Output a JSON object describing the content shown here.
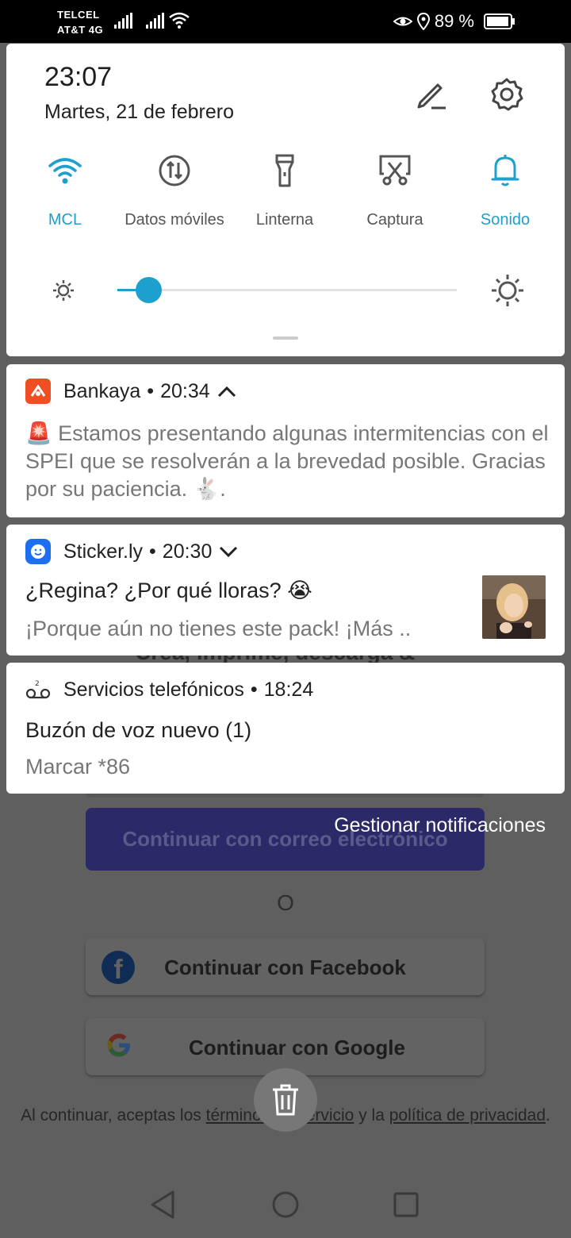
{
  "status_bar": {
    "carrier_1": "TELCEL",
    "carrier_2": "AT&T 4G",
    "battery": "89 %",
    "icons": [
      "signal-icon",
      "wifi-icon",
      "eye-comfort-icon",
      "location-icon",
      "battery-icon"
    ]
  },
  "quick_settings": {
    "time": "23:07",
    "date": "Martes, 21 de febrero",
    "tiles": [
      {
        "label": "MCL",
        "icon": "wifi-icon",
        "active": true
      },
      {
        "label": "Datos móviles",
        "icon": "mobile-data-icon",
        "active": false
      },
      {
        "label": "Linterna",
        "icon": "flashlight-icon",
        "active": false
      },
      {
        "label": "Captura",
        "icon": "screenshot-icon",
        "active": false
      },
      {
        "label": "Sonido",
        "icon": "bell-icon",
        "active": true
      }
    ],
    "brightness_level": 0.09,
    "accent": "#1ea0cf"
  },
  "notifications": [
    {
      "app": "Bankaya",
      "time": "20:34",
      "expanded": true,
      "body": "Estamos presentando algunas intermitencias con el SPEI que se resolverán a la brevedad posible. Gracias por su paciencia. .",
      "emoji_start": "🚨",
      "emoji_end": "🐇"
    },
    {
      "app": "Sticker.ly",
      "time": "20:30",
      "expanded": false,
      "title": "¿Regina? ¿Por qué lloras?",
      "title_emoji": "😭",
      "text": "¡Porque aún no tienes este pack!  ¡Más .."
    },
    {
      "app": "Servicios telefónicos",
      "time": "18:24",
      "title": "Buzón de voz nuevo (1)",
      "text": "Marcar *86"
    }
  ],
  "manage_label": "Gestionar notificaciones",
  "background_app": {
    "peek_text": "Crea, imprime, descarga &",
    "email_button": "Continuar con correo electrónico",
    "or": "O",
    "facebook_button": "Continuar con Facebook",
    "google_button": "Continuar con Google",
    "legal_1": "Al continuar, aceptas los",
    "legal_terms": "términos de servicio",
    "legal_2": "y la",
    "legal_privacy": "política de privacidad",
    "legal_3": "."
  }
}
